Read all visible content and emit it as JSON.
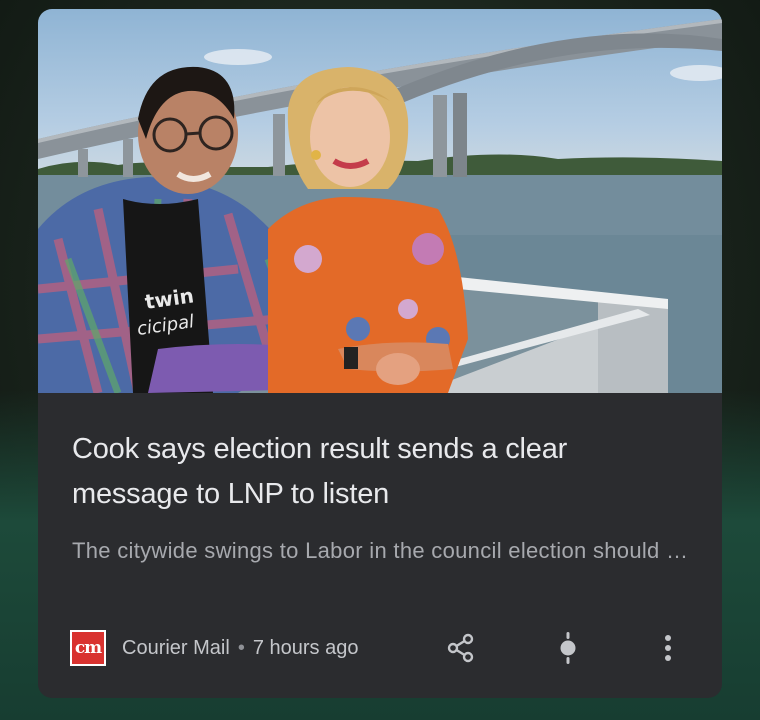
{
  "article": {
    "headline": "Cook says election result sends a clear message to LNP to listen",
    "snippet": "The citywide swings to Labor in the council election should serve as a warning to the LNP to listen to ra…",
    "image_shirt_text": "twin\ncicipal"
  },
  "source": {
    "logo_text": "cm",
    "name": "Courier Mail",
    "separator": "•",
    "time": "7 hours ago"
  },
  "actions": {
    "share_icon": "share-icon",
    "focus_icon": "lightbulb-icon",
    "more_icon": "more-vert-icon"
  },
  "colors": {
    "card": "#2b2c2f",
    "headline": "#e8e9ec",
    "snippet": "#a7a9ae",
    "logo": "#d9322f"
  }
}
